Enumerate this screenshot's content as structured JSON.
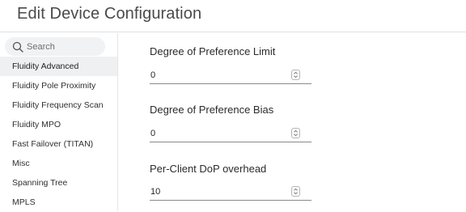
{
  "header": {
    "title": "Edit Device Configuration"
  },
  "sidebar": {
    "search": {
      "placeholder": "Search",
      "value": ""
    },
    "items": [
      {
        "label": "Fluidity Advanced",
        "active": true
      },
      {
        "label": "Fluidity Pole Proximity"
      },
      {
        "label": "Fluidity Frequency Scan"
      },
      {
        "label": "Fluidity MPO"
      },
      {
        "label": "Fast Failover (TITAN)"
      },
      {
        "label": "Misc"
      },
      {
        "label": "Spanning Tree"
      },
      {
        "label": "MPLS"
      }
    ]
  },
  "main": {
    "fields": [
      {
        "label": "Degree of Preference Limit",
        "value": "0"
      },
      {
        "label": "Degree of Preference Bias",
        "value": "0"
      },
      {
        "label": "Per-Client DoP overhead",
        "value": "10"
      }
    ]
  },
  "colors": {
    "active_item_bg": "#eef0f2",
    "border": "#dfe1e3",
    "underline": "#8a8a8a"
  }
}
